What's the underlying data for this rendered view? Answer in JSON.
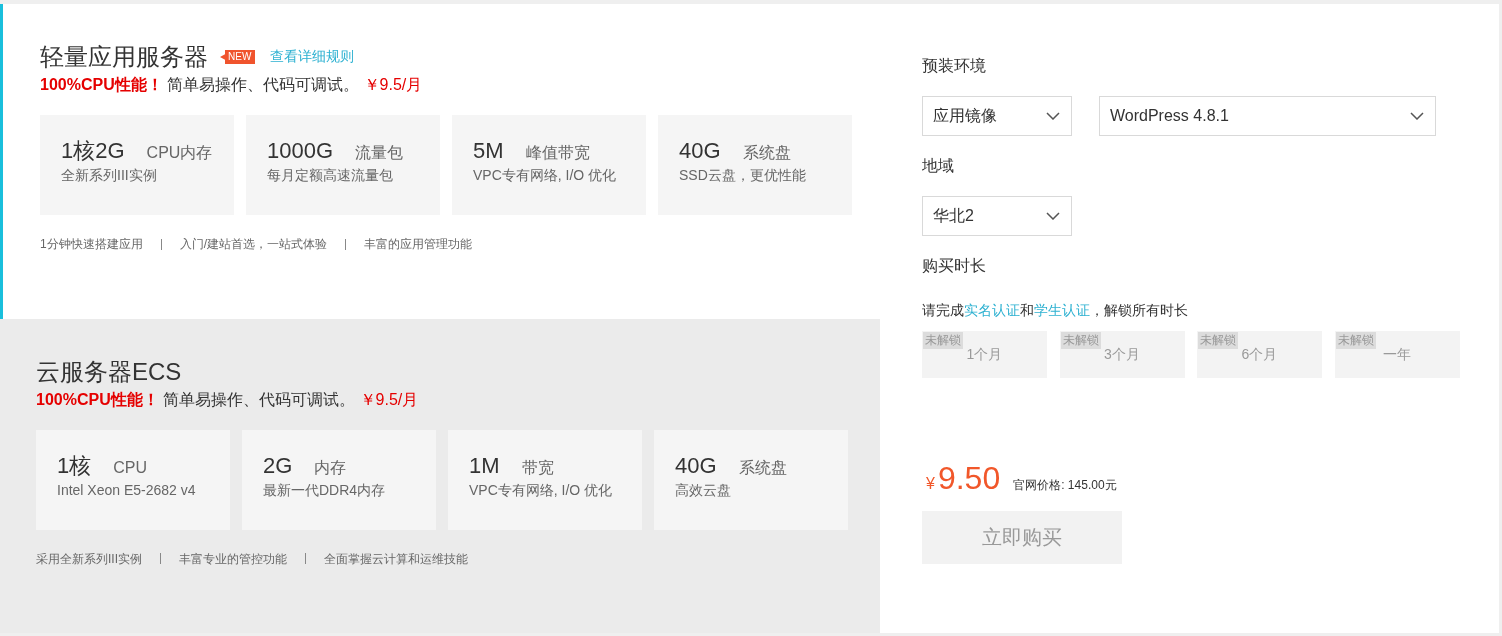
{
  "products": [
    {
      "title": "轻量应用服务器",
      "badge": "NEW",
      "link": "查看详细规则",
      "selected": true,
      "tagline": {
        "highlight": "100%CPU性能！",
        "text": "简单易操作、代码可调试。",
        "price": "￥9.5/月"
      },
      "specs": [
        {
          "value": "1核2G",
          "unit": "CPU内存",
          "desc": "全新系列III实例"
        },
        {
          "value": "1000G",
          "unit": "流量包",
          "desc": "每月定额高速流量包"
        },
        {
          "value": "5M",
          "unit": "峰值带宽",
          "desc": "VPC专有网络, I/O 优化"
        },
        {
          "value": "40G",
          "unit": "系统盘",
          "desc": "SSD云盘，更优性能"
        }
      ],
      "features": [
        "1分钟快速搭建应用",
        "入门/建站首选，一站式体验",
        "丰富的应用管理功能"
      ]
    },
    {
      "title": "云服务器ECS",
      "selected": false,
      "tagline": {
        "highlight": "100%CPU性能！",
        "text": "简单易操作、代码可调试。",
        "price": "￥9.5/月"
      },
      "specs": [
        {
          "value": "1核",
          "unit": "CPU",
          "desc": "Intel Xeon E5-2682 v4"
        },
        {
          "value": "2G",
          "unit": "内存",
          "desc": "最新一代DDR4内存"
        },
        {
          "value": "1M",
          "unit": "带宽",
          "desc": "VPC专有网络, I/O 优化"
        },
        {
          "value": "40G",
          "unit": "系统盘",
          "desc": "高效云盘"
        }
      ],
      "features": [
        "采用全新系列III实例",
        "丰富专业的管控功能",
        "全面掌握云计算和运维技能"
      ]
    }
  ],
  "order_panel": {
    "fields": [
      {
        "label": "预装环境",
        "selects": [
          {
            "value": "应用镜像"
          },
          {
            "value": "WordPress 4.8.1"
          }
        ]
      },
      {
        "label": "地域",
        "selects": [
          {
            "value": "华北2"
          }
        ]
      }
    ],
    "duration": {
      "label": "购买时长",
      "note": [
        {
          "kind": "text",
          "text": "请完成"
        },
        {
          "kind": "link",
          "text": "实名认证"
        },
        {
          "kind": "text",
          "text": "和"
        },
        {
          "kind": "link",
          "text": "学生认证"
        },
        {
          "kind": "text",
          "text": "，解锁所有时长"
        }
      ],
      "options": [
        {
          "label": "1个月",
          "badge": "未解锁",
          "disabled": true,
          "selected": false
        },
        {
          "label": "3个月",
          "badge": "未解锁",
          "disabled": true,
          "selected": false
        },
        {
          "label": "6个月",
          "badge": "未解锁",
          "disabled": true,
          "selected": false
        },
        {
          "label": "一年",
          "badge": "未解锁",
          "disabled": true,
          "selected": false
        }
      ]
    },
    "price": {
      "currency": "¥",
      "amount": "9.50",
      "list_price": "官网价格: 145.00元"
    },
    "buy_button": {
      "label": "立即购买",
      "disabled": true
    }
  }
}
